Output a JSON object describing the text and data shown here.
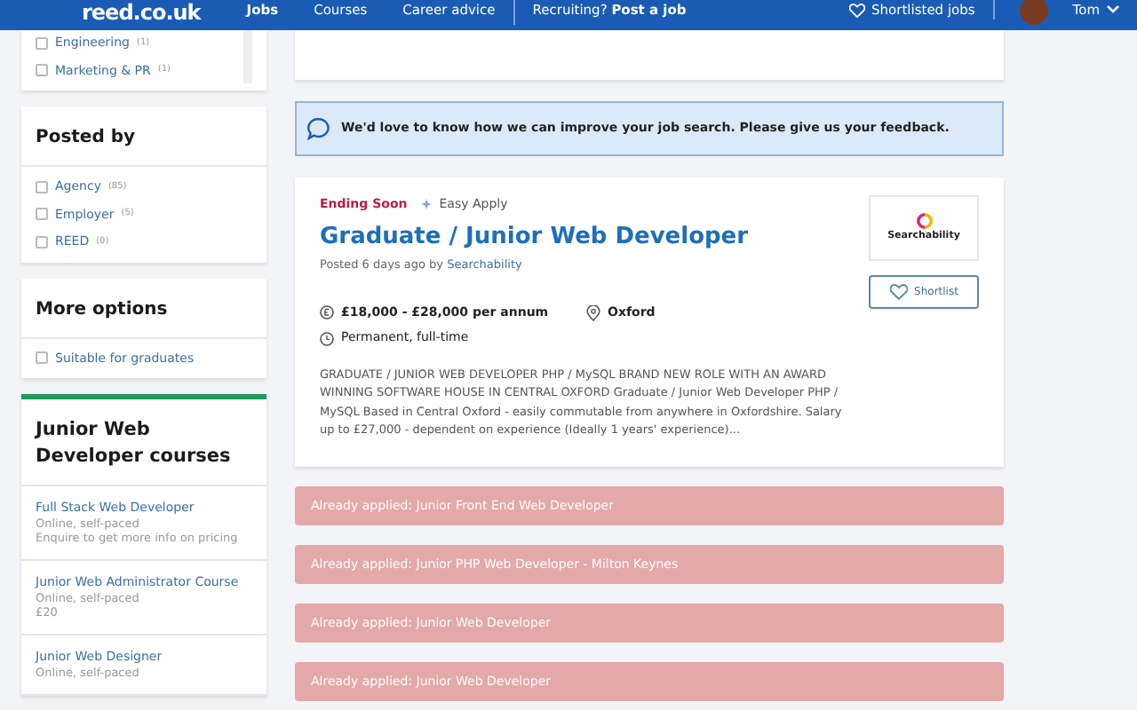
{
  "navbar": {
    "logo": "reed.co.uk",
    "links": [
      {
        "label": "Jobs",
        "selected": true
      },
      {
        "label": "Courses",
        "selected": false
      },
      {
        "label": "Career advice",
        "selected": false
      }
    ],
    "recruiting": "Recruiting? **Post a job**",
    "shortlisted": "Shortlisted jobs",
    "user": "Tom"
  },
  "filters": [
    {
      "items": [
        {
          "label": "Engineering",
          "count": "(1)",
          "checked": false
        },
        {
          "label": "Marketing & PR",
          "count": "(1)",
          "checked": false
        }
      ]
    },
    {
      "title": "Posted by",
      "items": [
        {
          "label": "Agency",
          "count": "(85)",
          "checked": false
        },
        {
          "label": "Employer",
          "count": "(5)",
          "checked": false
        },
        {
          "label": "REED",
          "count": "(0)",
          "checked": false
        }
      ]
    },
    {
      "title": "More options",
      "items": [
        {
          "label": "Suitable for graduates",
          "checked": false
        }
      ]
    }
  ],
  "courses": {
    "title": "Junior Web Developer courses",
    "items": [
      {
        "name": "Full Stack Web Developer",
        "lines": [
          "Online, self-paced",
          "Enquire to get more info on pricing"
        ]
      },
      {
        "name": "Junior Web Administrator Course",
        "lines": [
          "Online, self-paced",
          "£20"
        ]
      },
      {
        "name": "Junior Web Designer",
        "lines": [
          "Online, self-paced"
        ]
      }
    ]
  },
  "feedback": {
    "text": "We'd love to know how we can improve your job search.",
    "link": "Please give us your feedback."
  },
  "job": {
    "ending": "Ending Soon",
    "easy_apply": "Easy Apply",
    "title": "Graduate / Junior Web Developer",
    "posted": "Posted 6 days ago by",
    "company": "Searchability",
    "logo": "Searchability",
    "shortlist": "Shortlist",
    "salary": "£18,000 - £28,000 per annum",
    "location": "Oxford",
    "type": "Permanent, full-time",
    "description": "GRADUATE / JUNIOR WEB DEVELOPER PHP / MySQL BRAND NEW ROLE WITH AN AWARD WINNING SOFTWARE HOUSE IN CENTRAL OXFORD Graduate / Junior Web Developer PHP / MySQL Based in Central Oxford - easily commutable from anywhere in Oxfordshire. Salary up to £27,000 - dependent on experience (Ideally 1 years' experience)..."
  },
  "applied": [
    {
      "label": "Already applied:",
      "title": "Junior Front End Web Developer"
    },
    {
      "label": "Already applied:",
      "title": "Junior PHP Web Developer - Milton Keynes"
    },
    {
      "label": "Already applied:",
      "title": "Junior Web Developer"
    },
    {
      "label": "Already applied:",
      "title": "Junior Web Developer"
    }
  ]
}
